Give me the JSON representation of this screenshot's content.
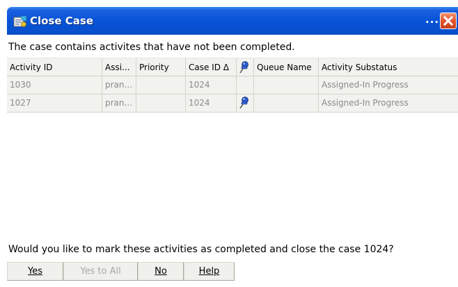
{
  "window": {
    "title": "Close Case",
    "title_overflow": "...",
    "icon": "case-close-icon"
  },
  "message": "The case contains activites that have not been completed.",
  "table": {
    "headers": [
      "Activity ID",
      "Assi...",
      "Priority",
      "Case ID Δ",
      "",
      "Queue Name",
      "Activity Substatus"
    ],
    "header_icon": "pushpin-icon",
    "rows": [
      {
        "activity_id": "1030",
        "assigned": "pran...",
        "priority": "",
        "case_id": "1024",
        "pinned": false,
        "queue_name": "",
        "substatus": "Assigned-In Progress"
      },
      {
        "activity_id": "1027",
        "assigned": "pran...",
        "priority": "",
        "case_id": "1024",
        "pinned": true,
        "queue_name": "",
        "substatus": "Assigned-In Progress"
      }
    ]
  },
  "question": "Would you like to mark these activities as completed and close the case 1024?",
  "buttons": {
    "yes": {
      "label": "Yes",
      "enabled": true
    },
    "yes_to_all": {
      "label": "Yes to All",
      "enabled": false
    },
    "no": {
      "label": "No",
      "enabled": true
    },
    "help": {
      "label": "Help",
      "enabled": true
    }
  },
  "colors": {
    "titlebar": "#0a54d8",
    "close_button": "#e2542b",
    "row_background": "#f2f2ee",
    "disabled_text": "#8a8a8a"
  }
}
